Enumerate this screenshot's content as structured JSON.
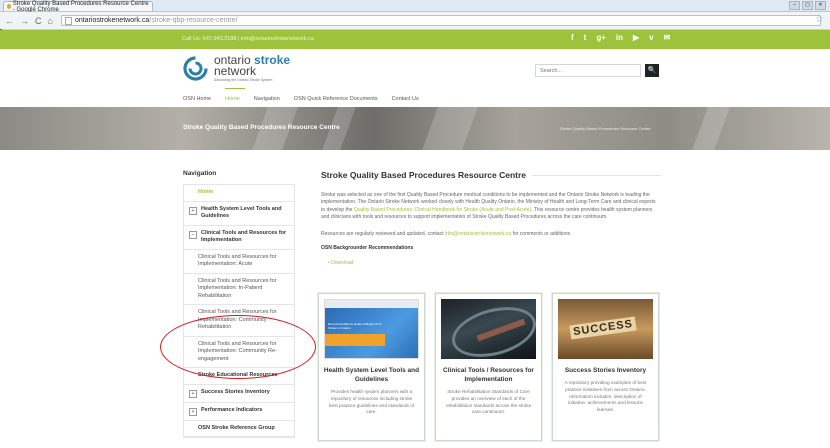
{
  "browser": {
    "tab_title": "Stroke Quality Based Procedures Resource Centre - Google Chrome",
    "url_domain": "ontariostrokenetwork.ca",
    "url_path": "/stroke-qbp-resource-centre/",
    "win_controls": [
      "–",
      "▢",
      "✕"
    ]
  },
  "topbar": {
    "contact": "Call Us: 647.943.3188  |  info@ontariostrokenetwork.ca",
    "social": [
      "f",
      "t",
      "g+",
      "in",
      "▶",
      "v",
      "✉"
    ]
  },
  "logo": {
    "line1_a": "ontario",
    "line1_b": "stroke",
    "line2": "network",
    "tagline": "Advancing the Ontario Stroke System"
  },
  "search": {
    "placeholder": "Search...",
    "button": "🔍"
  },
  "menu": [
    "OSN Home",
    "Home",
    "Navigation",
    "OSN Quick Reference Documents",
    "Contact Us"
  ],
  "banner": {
    "title": "Stroke Quality Based Procedures Resource Centre",
    "breadcrumb": "Stroke Quality Based Procedures Resource Centre"
  },
  "sidebar": {
    "heading": "Navigation",
    "items": [
      "Home",
      "Health System Level Tools and Guidelines",
      "Clinical Tools and Resources for Implementation",
      "Clinical Tools and Resources for Implementation: Acute",
      "Clinical Tools and Resources for Implementation: In-Patient Rehabilitation",
      "Clinical Tools and Resources for Implementation: Community Rehabilitation",
      "Clinical Tools and Resources for Implementation: Community Re-engagement",
      "Stroke Educational Resources",
      "Success Stories Inventory",
      "Performance Indicators",
      "OSN Stroke Reference Group"
    ],
    "toggle_plus": "+",
    "toggle_minus": "−"
  },
  "main": {
    "title": "Stroke Quality Based Procedures Resource Centre",
    "para1_a": "Stroke was selected as one of the first Quality Based Procedure medical conditions to be implemented and the Ontario Stroke Network is leading the implementation. The Ontario Stroke Network worked closely with Health Quality Ontario, the Ministry of Health and Long-Term Care and clinical experts to develop the",
    "para1_link": "Quality Based Procedures: Clinical Handbook for Stroke (Acute and Post-Acute)",
    "para1_b": ". This resource centre provides health system planners and clinicians with tools and resources to support implementation of Stroke Quality Based Procedures across the care continuum.",
    "para2_a": "Resources are regularly reviewed and updated, contact",
    "para2_link": "info@ontariostrokenetwork.ca",
    "para2_b": "for comments or additions",
    "subhead": "OSN Backgrounder Recommendations",
    "download": "Download"
  },
  "cards": [
    {
      "title": "Health System Level Tools and Guidelines",
      "desc": "Provides health system planners with a repository of resources including stroke best practice guidelines and standards of care.",
      "img_caption": "Recommendations Guide & Blueprint for Stroke in Ontario"
    },
    {
      "title": "Clinical Tools / Resources for Implementation",
      "desc": "Stroke Rehabilitation Standards of Care provides an overview of each of the rehabilitation standards across the stroke care continuum."
    },
    {
      "title": "Success Stories Inventory",
      "desc": "A repository providing examples of best practice initiatives from across Ontario. Information includes: description of initiative, achievements and lessons learned.",
      "img_text": "SUCCESS"
    }
  ],
  "colors": {
    "accent_green": "#9dc23b",
    "annotation_red": "#d7191c"
  }
}
